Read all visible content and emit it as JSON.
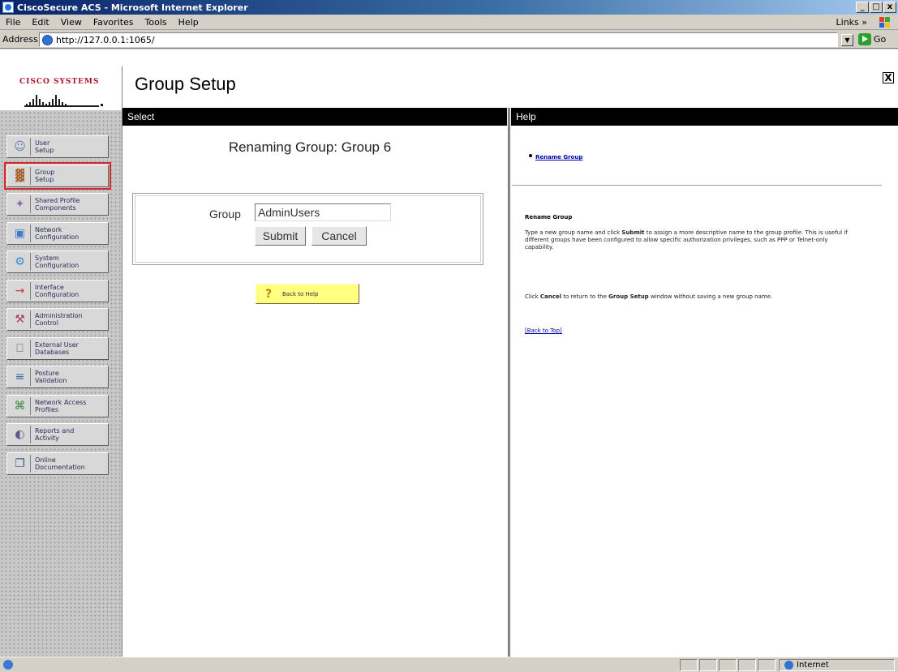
{
  "window": {
    "title": "CiscoSecure ACS - Microsoft Internet Explorer",
    "minimize": "_",
    "maximize": "□",
    "close": "x"
  },
  "menu": {
    "items": [
      "File",
      "Edit",
      "View",
      "Favorites",
      "Tools",
      "Help"
    ],
    "links": "Links »"
  },
  "address": {
    "label": "Address",
    "url": "http://127.0.0.1:1065/",
    "go": "Go"
  },
  "logo": {
    "text": "Cisco Systems"
  },
  "nav": [
    {
      "line1": "User",
      "line2": "Setup",
      "icon": "user-setup-icon"
    },
    {
      "line1": "Group",
      "line2": "Setup",
      "icon": "group-setup-icon",
      "selected": true
    },
    {
      "line1": "Shared Profile",
      "line2": "Components",
      "icon": "shared-profile-icon"
    },
    {
      "line1": "Network",
      "line2": "Configuration",
      "icon": "network-config-icon"
    },
    {
      "line1": "System",
      "line2": "Configuration",
      "icon": "system-config-icon"
    },
    {
      "line1": "Interface",
      "line2": "Configuration",
      "icon": "interface-config-icon"
    },
    {
      "line1": "Administration",
      "line2": "Control",
      "icon": "admin-control-icon"
    },
    {
      "line1": "External User",
      "line2": "Databases",
      "icon": "external-db-icon"
    },
    {
      "line1": "Posture",
      "line2": "Validation",
      "icon": "posture-icon"
    },
    {
      "line1": "Network Access",
      "line2": "Profiles",
      "icon": "network-access-icon"
    },
    {
      "line1": "Reports and",
      "line2": "Activity",
      "icon": "reports-icon"
    },
    {
      "line1": "Online",
      "line2": "Documentation",
      "icon": "documentation-icon"
    }
  ],
  "header": {
    "title": "Group Setup",
    "close": "X"
  },
  "select": {
    "bar_label": "Select",
    "heading": "Renaming Group: Group 6",
    "group_label": "Group",
    "group_value": "AdminUsers",
    "submit": "Submit",
    "cancel": "Cancel",
    "back_to_help": "Back to Help"
  },
  "help": {
    "bar_label": "Help",
    "link": "Rename Group",
    "heading": "Rename Group",
    "p1_a": "Type a new group name and click ",
    "p1_b": "Submit",
    "p1_c": " to assign a more descriptive name to the group profile. This is useful if different groups have been configured to allow specific authorization privileges, such as PPP or Telnet-only capability.",
    "p2_a": "Click ",
    "p2_b": "Cancel",
    "p2_c": " to return to the ",
    "p2_d": "Group Setup",
    "p2_e": " window without saving a new group name.",
    "back_to_top": "[Back to Top]"
  },
  "status": {
    "zone": "Internet"
  }
}
